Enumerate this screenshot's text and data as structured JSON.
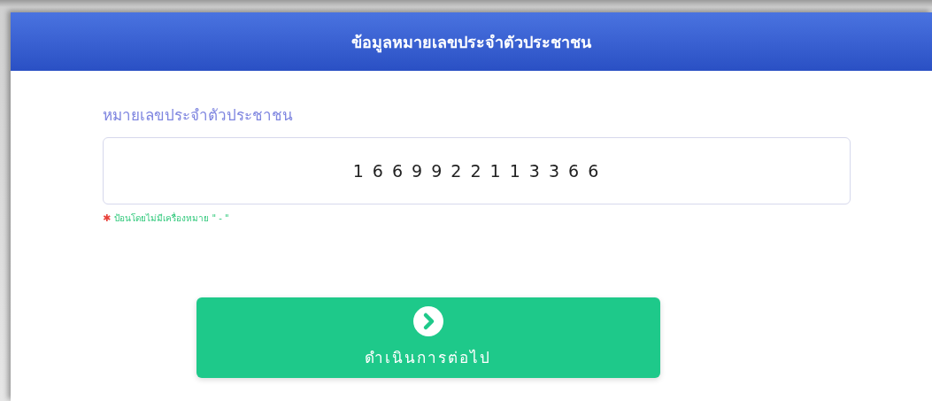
{
  "header": {
    "title": "ข้อมูลหมายเลขประจำตัวประชาชน"
  },
  "form": {
    "label": "หมายเลขประจำตัวประชาชน",
    "id_field": {
      "value": "1 6 6 9 9 2 2 1 1 3 3 6 6"
    },
    "hint_mark": "✱",
    "hint": "ป้อนโดยไม่มีเครื่องหมาย \" - \""
  },
  "button": {
    "label": "ดำเนินการต่อไป"
  }
}
